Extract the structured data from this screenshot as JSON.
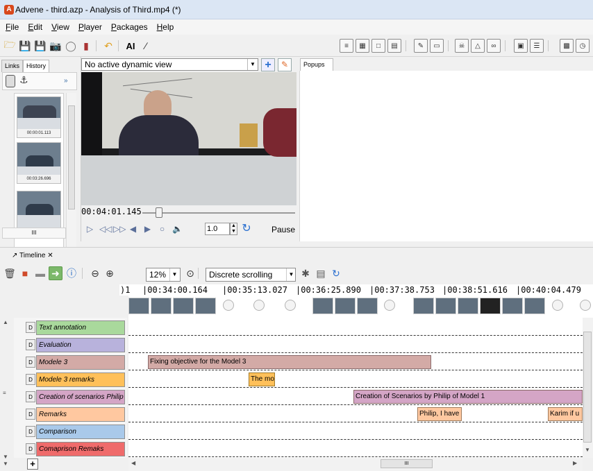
{
  "window": {
    "title": "Advene - third.azp - Analysis of Third.mp4 (*)",
    "logo_colors": {
      "accent": "#d8481c"
    }
  },
  "menu": [
    "File",
    "Edit",
    "View",
    "Player",
    "Packages",
    "Help"
  ],
  "toolbar": {
    "ai_label": "AI"
  },
  "left_panel": {
    "tabs": [
      "Links",
      "History"
    ],
    "active_tab": "History",
    "nav_label": "»",
    "history": [
      {
        "time": "00:00:01.113"
      },
      {
        "time": "00:03:26.696"
      },
      {
        "time": ""
      }
    ],
    "hscroll_label": "III"
  },
  "player": {
    "view_combo": "No active dynamic view",
    "timecode": "00:04:01.145",
    "rate": "1.0",
    "pause_label": "Pause",
    "position_fraction": 0.1
  },
  "popups": {
    "tab_label": "Popups"
  },
  "timeline": {
    "tab_label": "Timeline",
    "close_label": "✕",
    "zoom": "12%",
    "scroll_mode": "Discrete scrolling",
    "ruler": [
      "|00:34:00.164",
      "|00:35:13.027",
      "|00:36:25.890",
      "|00:37:38.753",
      "|00:38:51.616",
      "|00:40:04.479"
    ],
    "ruler_prefix": ")1",
    "tracks": [
      {
        "name": "Text annotation",
        "color": "#a9d99c"
      },
      {
        "name": "Evaluation",
        "color": "#b8b2dc"
      },
      {
        "name": "Modele 3",
        "color": "#d3aaa6"
      },
      {
        "name": "Modele 3 remarks",
        "color": "#ffc05a"
      },
      {
        "name": "Creation of scenarios Philip",
        "color": "#d4a5c6"
      },
      {
        "name": "Remarks",
        "color": "#ffc8a0"
      },
      {
        "name": "Comparison",
        "color": "#a9c9ea"
      },
      {
        "name": "Comaprison Remaks",
        "color": "#ef6b6b"
      }
    ],
    "annotations": [
      {
        "text": "Fixing objective for the Model 3",
        "track": 2
      },
      {
        "text": "The mo",
        "track": 3
      },
      {
        "text": "Creation of Scenarios by Philip of Model 1",
        "track": 4
      },
      {
        "text": "Philip, I have",
        "track": 5
      },
      {
        "text": "Karim if u",
        "track": 5
      }
    ],
    "hscroll_label": "III",
    "add_label": "+"
  }
}
